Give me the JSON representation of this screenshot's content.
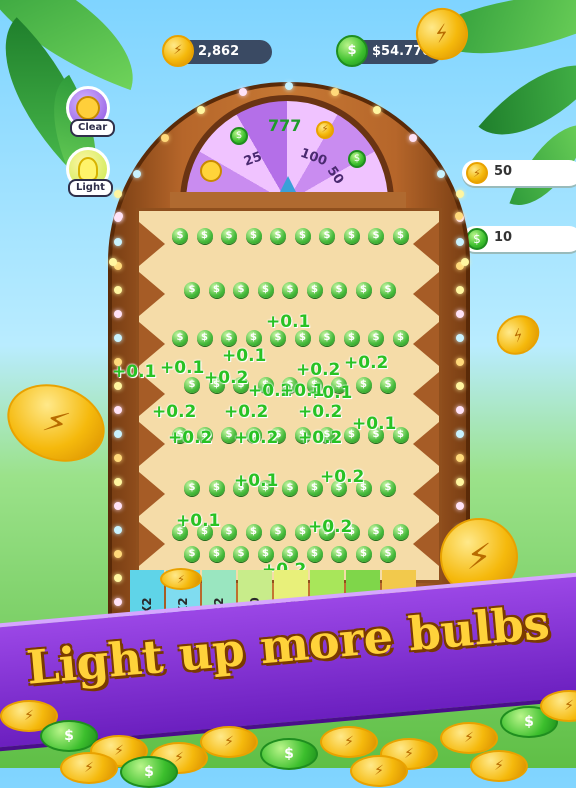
{
  "top_bar": {
    "coin_balance": "2,862",
    "cash_balance": "$54.770"
  },
  "side_buttons": {
    "clear_label": "Clear",
    "light_label": "Light"
  },
  "right_rewards": [
    {
      "value": "50"
    },
    {
      "value": "10"
    }
  ],
  "wheel": {
    "segments": [
      "25",
      "100",
      "50"
    ],
    "jackpot": "777"
  },
  "peg_symbol": "$",
  "floating_rewards": [
    "+0.1",
    "+0.1",
    "+0.1",
    "+0.2",
    "+0.2",
    "+0.2",
    "+0.2",
    "+0.1",
    "+0.2",
    "+0.2",
    "+0.2",
    "+0.1",
    "+0.2",
    "+0.2",
    "+0.2",
    "+0.2",
    "+0.1",
    "+0.2",
    "+0.1",
    "+0.2",
    "+0.1",
    "+0.1"
  ],
  "multiplier_slots": [
    "X2",
    "X2",
    "X2",
    "10",
    "X2",
    "",
    "",
    ""
  ],
  "slot_colors": [
    "#5fd4e8",
    "#7fdcf0",
    "#9ae6c0",
    "#c8ec8a",
    "#e8f07a",
    "#a8e65a",
    "#7fd64a",
    "#f2c94c"
  ],
  "colors": {
    "banner": "#8a3ad6",
    "banner_text": "#ffd23a",
    "peg_green": "#45b93a",
    "reward_green": "#28c224",
    "wood": "#b6662a"
  },
  "banner": {
    "text": "Light up more bulbs"
  }
}
